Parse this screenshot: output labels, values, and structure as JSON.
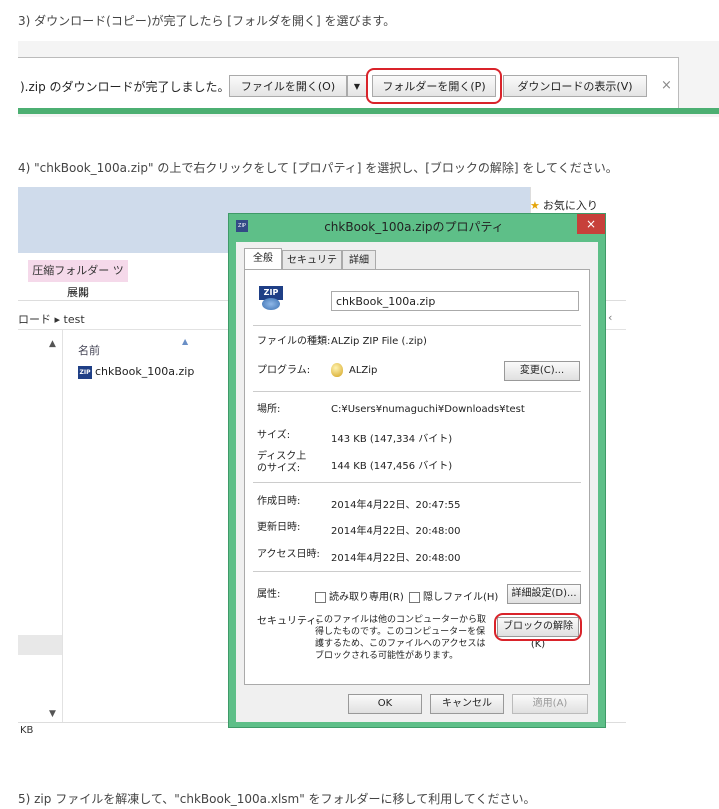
{
  "steps": {
    "step3": "3) ダウンロード(コピー)が完了したら [フォルダを開く] を選びます。",
    "step4": "4) \"chkBook_100a.zip\" の上で右クリックをして [プロパティ] を選択し、[ブロックの解除] をしてください。",
    "step5": "5) zip ファイルを解凍して、\"chkBook_100a.xlsm\" をフォルダーに移して利用してください。"
  },
  "download_bar": {
    "message": ").zip のダウンロードが完了しました。",
    "open_file": "ファイルを開く(O)",
    "dropdown_arrow": "▼",
    "open_folder": "フォルダーを開く(P)",
    "show_downloads": "ダウンロードの表示(V)",
    "close": "×"
  },
  "explorer": {
    "favorites": "お気に入り",
    "ribbon_tool": "圧縮フォルダー ツール",
    "ribbon_open": "展開",
    "address": "ロード ▸ test",
    "address_right": "‹",
    "column_name": "名前",
    "file_name": "chkBook_100a.zip",
    "status": "KB",
    "up_arrow": "▲",
    "down_arrow": "▼",
    "sort_arrow": "▲"
  },
  "dialog": {
    "title": "chkBook_100a.zipのプロパティ",
    "close": "×",
    "tabs": [
      "全般",
      "セキュリティ",
      "詳細"
    ],
    "file_icon_text": "ZIP",
    "name_value": "chkBook_100a.zip",
    "type_label": "ファイルの種類:",
    "type_value": "ALZip ZIP File (.zip)",
    "program_label": "プログラム:",
    "program_value": "ALZip",
    "change_button": "変更(C)...",
    "location_label": "場所:",
    "location_value": "C:¥Users¥numaguchi¥Downloads¥test",
    "size_label": "サイズ:",
    "size_value": "143 KB (147,334 バイト)",
    "disk_label_1": "ディスク上",
    "disk_label_2": "のサイズ:",
    "disk_value": "144 KB (147,456 バイト)",
    "created_label": "作成日時:",
    "created_value": "2014年4月22日、20:47:55",
    "modified_label": "更新日時:",
    "modified_value": "2014年4月22日、20:48:00",
    "accessed_label": "アクセス日時:",
    "accessed_value": "2014年4月22日、20:48:00",
    "attributes_label": "属性:",
    "readonly_label": "読み取り専用(R)",
    "hidden_label": "隠しファイル(H)",
    "advanced_button": "詳細設定(D)...",
    "security_label": "セキュリティ:",
    "security_text": "このファイルは他のコンピューターから取得したものです。このコンピューターを保護するため、このファイルへのアクセスはブロックされる可能性があります。",
    "unblock_button": "ブロックの解除(K)",
    "ok_button": "OK",
    "cancel_button": "キャンセル",
    "apply_button": "適用(A)"
  },
  "colors": {
    "highlight_ring": "#d9232a",
    "dialog_frame": "#5ebf88",
    "download_bar_accent": "#4caf72"
  }
}
